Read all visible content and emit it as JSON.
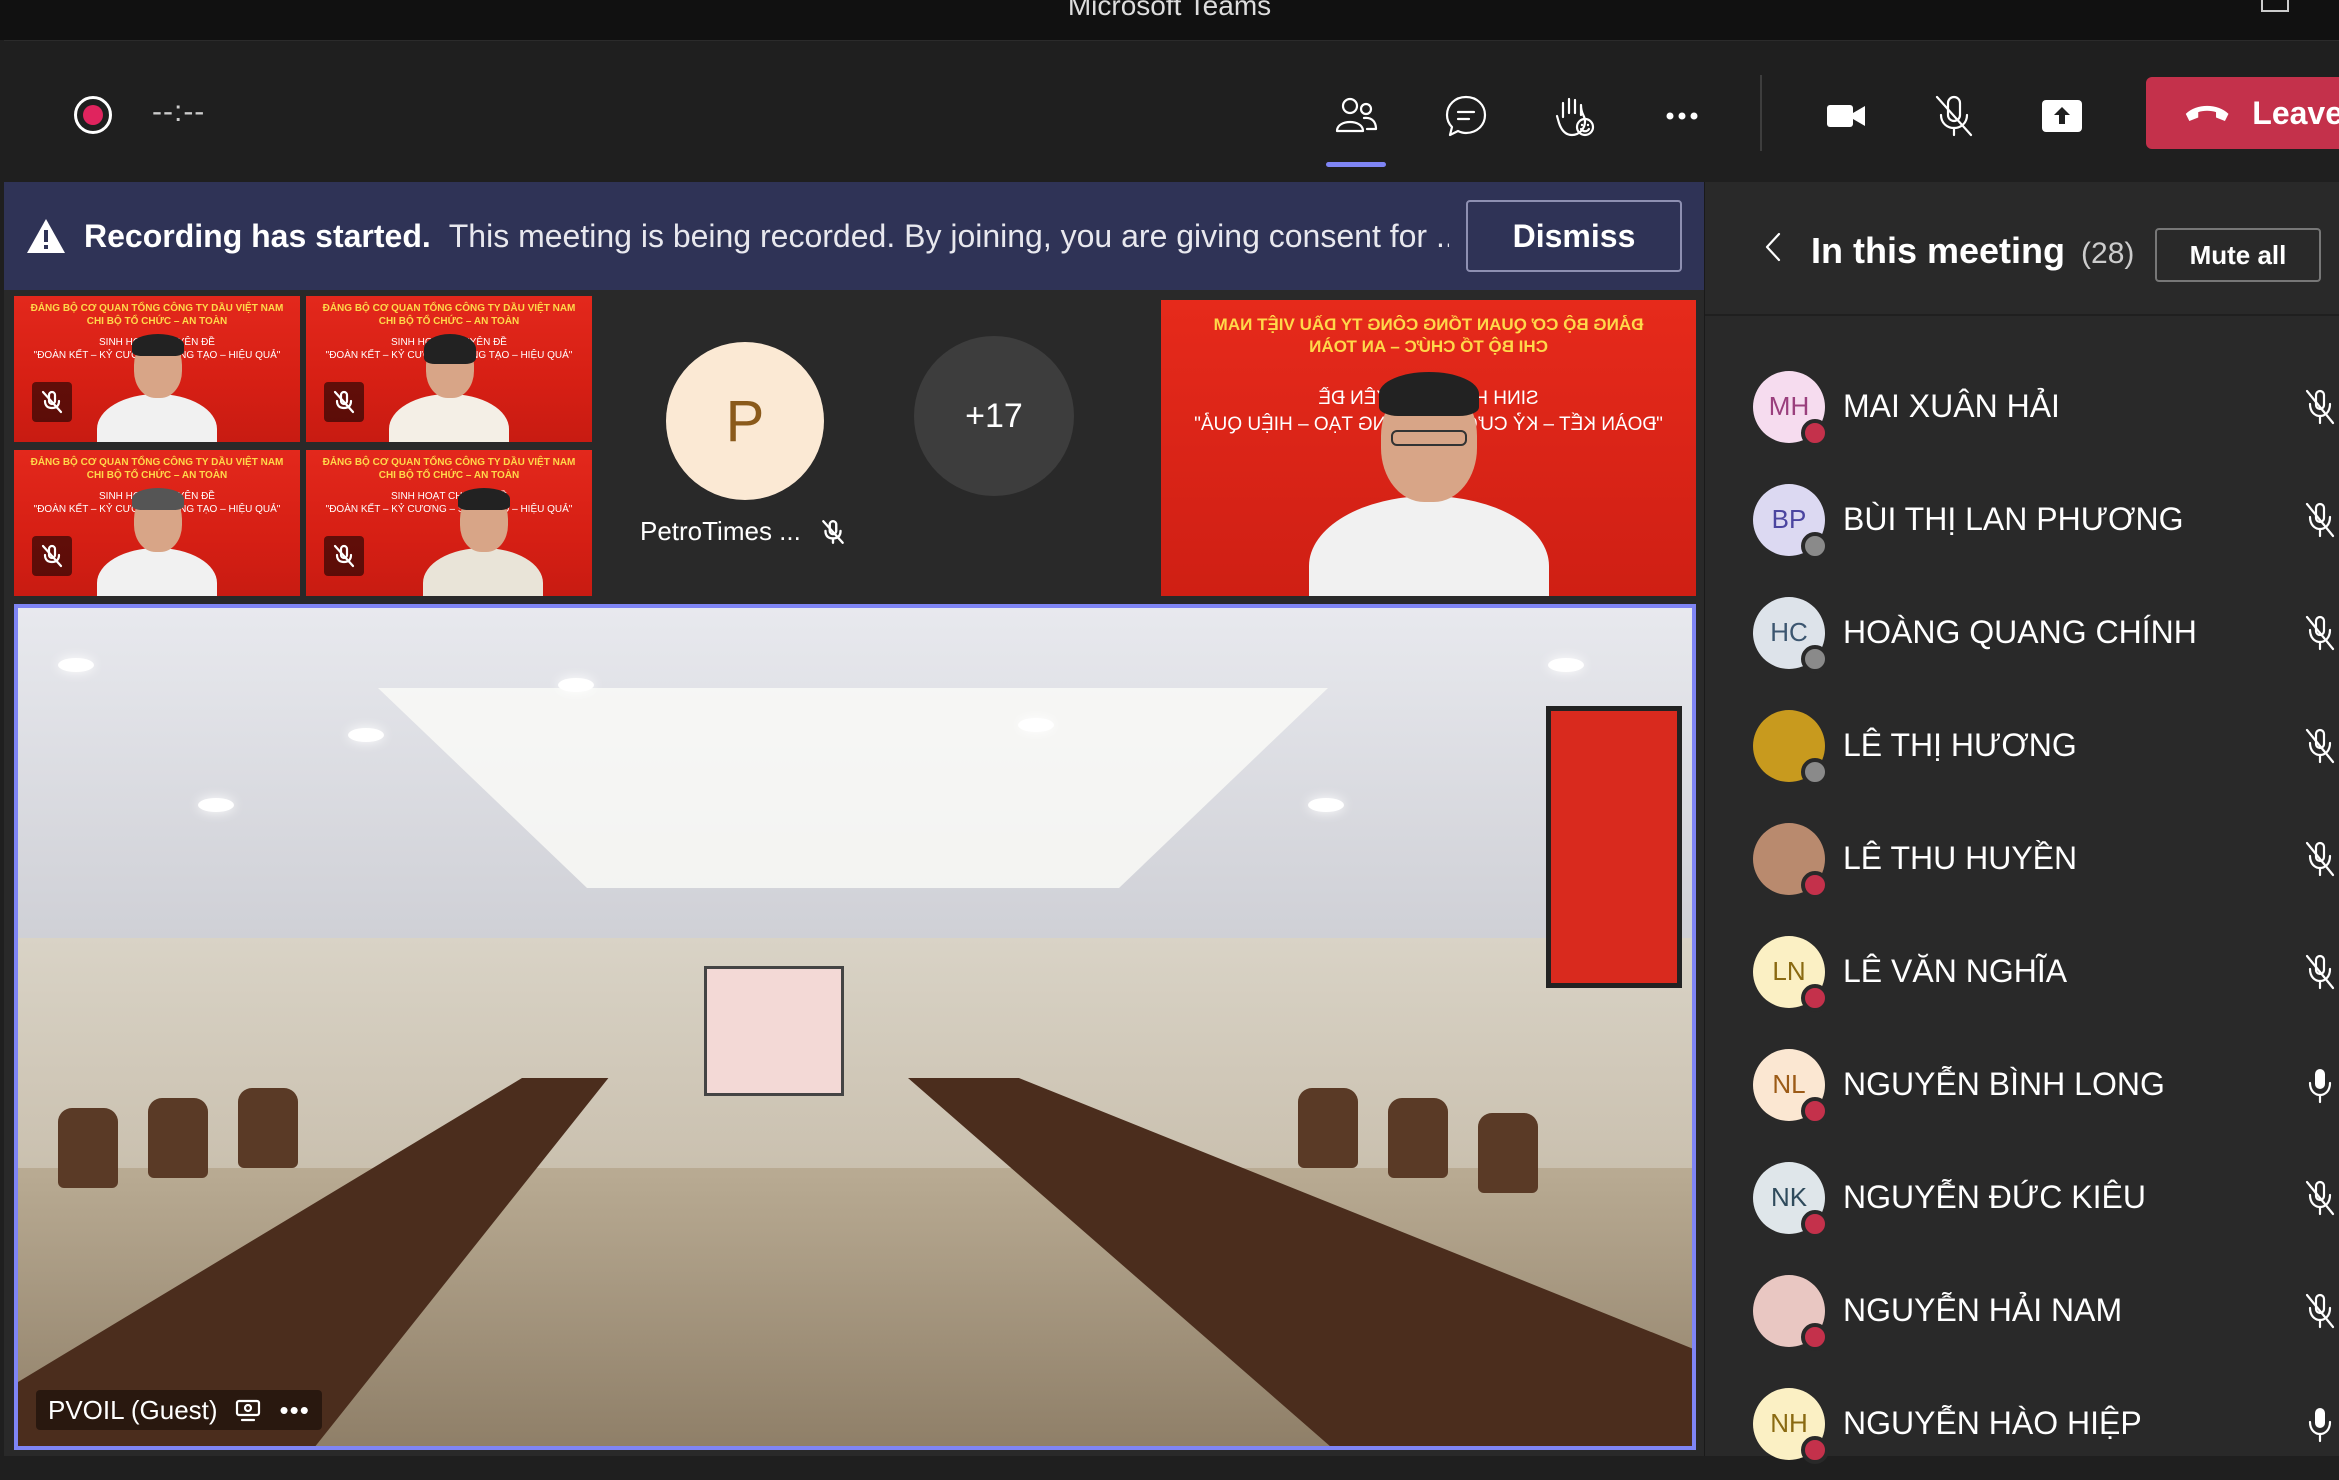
{
  "window": {
    "title": "Microsoft Teams"
  },
  "controls": {
    "timer": "--:--",
    "leave_label": "Leave",
    "accent": "#7f85f5",
    "leave_color": "#c4314b"
  },
  "banner": {
    "title": "Recording has started.",
    "message": "This meeting is being recorded. By joining, you are giving consent for ...",
    "dismiss_label": "Dismiss"
  },
  "stage": {
    "participant_initial": "P",
    "participant_name": "PetroTimes ...",
    "overflow_count": "+17",
    "thumb_banner_line1": "ĐẢNG BỘ CƠ QUAN TỔNG CÔNG TY DẦU VIỆT NAM",
    "thumb_banner_line2": "CHI BỘ TỔ CHỨC – AN TOÀN",
    "thumb_banner_line3": "SINH HOẠT CHUYÊN ĐỀ",
    "thumb_banner_line4": "\"ĐOÀN KẾT – KỶ CƯƠNG – SÁNG TẠO – HIỆU QUẢ\"",
    "main_video_label": "PVOIL (Guest)"
  },
  "panel": {
    "title": "In this meeting",
    "count": "(28)",
    "mute_all_label": "Mute all",
    "participants": [
      {
        "initials": "MH",
        "name": "MAI XUÂN HẢI",
        "avatar_bg": "#f6dcef",
        "avatar_fg": "#9a3f7d",
        "status": "#c4314b",
        "mic": "muted"
      },
      {
        "initials": "BP",
        "name": "BÙI THỊ LAN PHƯƠNG",
        "avatar_bg": "#dcd9f2",
        "avatar_fg": "#4b45a0",
        "status": "#8a8a8a",
        "mic": "muted"
      },
      {
        "initials": "HC",
        "name": "HOÀNG QUANG CHÍNH",
        "avatar_bg": "#dde3ea",
        "avatar_fg": "#3c5670",
        "status": "#8a8a8a",
        "mic": "muted"
      },
      {
        "initials": "",
        "name": "LÊ THỊ HƯƠNG",
        "avatar_bg": "#c89a1e",
        "avatar_fg": "#fff",
        "status": "#8a8a8a",
        "mic": "muted"
      },
      {
        "initials": "",
        "name": "LÊ THU HUYỀN",
        "avatar_bg": "#b98a6e",
        "avatar_fg": "#fff",
        "status": "#c4314b",
        "mic": "muted"
      },
      {
        "initials": "LN",
        "name": "LÊ VĂN NGHĨA",
        "avatar_bg": "#fbf0c4",
        "avatar_fg": "#8a6a12",
        "status": "#c4314b",
        "mic": "muted"
      },
      {
        "initials": "NL",
        "name": "NGUYỄN BÌNH LONG",
        "avatar_bg": "#fbe7d2",
        "avatar_fg": "#9c5b17",
        "status": "#c4314b",
        "mic": "on"
      },
      {
        "initials": "NK",
        "name": "NGUYỄN ĐỨC KIÊU",
        "avatar_bg": "#dfe6ea",
        "avatar_fg": "#2f4b5c",
        "status": "#c4314b",
        "mic": "muted"
      },
      {
        "initials": "",
        "name": "NGUYỄN HẢI NAM",
        "avatar_bg": "#e9c7c2",
        "avatar_fg": "#fff",
        "status": "#c4314b",
        "mic": "muted"
      },
      {
        "initials": "NH",
        "name": "NGUYỄN HÀO HIỆP",
        "avatar_bg": "#fbf0c4",
        "avatar_fg": "#8a6a12",
        "status": "#c4314b",
        "mic": "on"
      }
    ]
  }
}
